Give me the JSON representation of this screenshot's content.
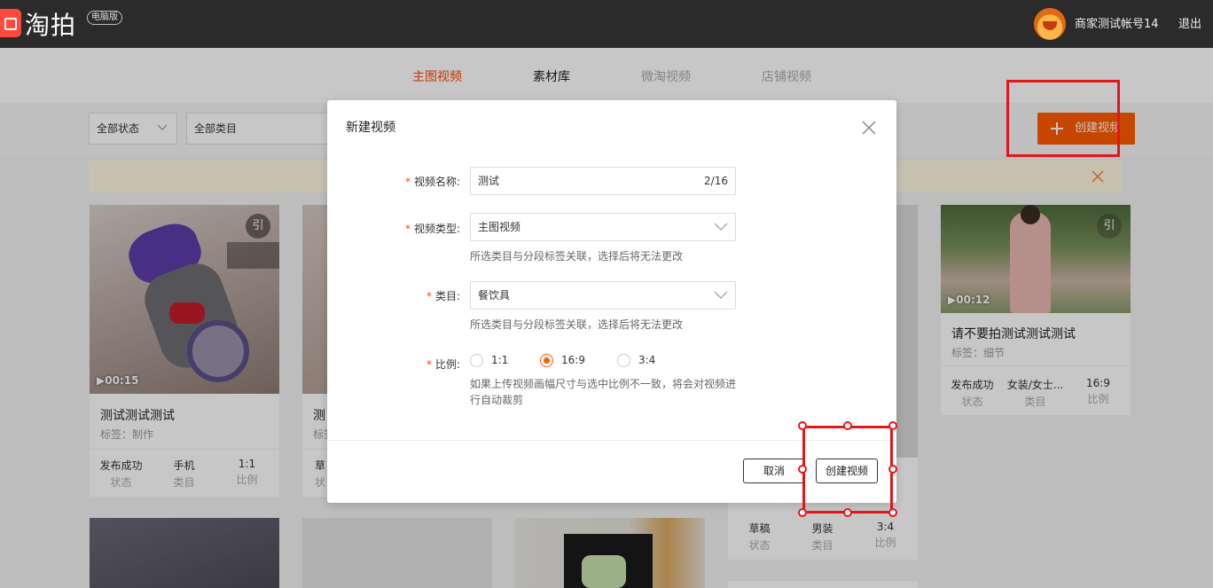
{
  "topbar": {
    "logo_text": "淘拍",
    "logo_badge": "电脑版",
    "user_name": "商家测试帐号14",
    "logout": "退出"
  },
  "nav": {
    "tabs": [
      {
        "label": "主图视频",
        "state": "active"
      },
      {
        "label": "素材库",
        "state": "normal"
      },
      {
        "label": "微淘视频",
        "state": "disabled"
      },
      {
        "label": "店铺视频",
        "state": "disabled"
      }
    ]
  },
  "filters": {
    "status": "全部状态",
    "category": "全部类目",
    "create_button": "创建视频"
  },
  "cards": [
    {
      "title": "测试测试测试",
      "tag": "标签：制作",
      "duration": "00:15",
      "quote": "引",
      "stats": [
        {
          "v": "发布成功",
          "k": "状态"
        },
        {
          "v": "手机",
          "k": "类目"
        },
        {
          "v": "1:1",
          "k": "比例"
        }
      ]
    },
    {
      "title": "测",
      "tag": "标签",
      "stats": [
        {
          "v": "草",
          "k": "状"
        }
      ]
    },
    {
      "title": "",
      "tag": "",
      "stats": [
        {
          "v": "草稿",
          "k": "状态"
        },
        {
          "v": "男装",
          "k": "类目"
        },
        {
          "v": "3:4",
          "k": "比例"
        }
      ]
    },
    {
      "title": "请不要拍测试测试测试",
      "tag": "标签：细节",
      "duration": "00:12",
      "quote": "引",
      "stats": [
        {
          "v": "发布成功",
          "k": "状态"
        },
        {
          "v": "女装/女士...",
          "k": "类目"
        },
        {
          "v": "16:9",
          "k": "比例"
        }
      ]
    }
  ],
  "modal": {
    "title": "新建视频",
    "name_label": "视频名称:",
    "name_value": "测试",
    "name_counter": "2/16",
    "type_label": "视频类型:",
    "type_value": "主图视频",
    "type_hint": "所选类目与分段标签关联，选择后将无法更改",
    "category_label": "类目:",
    "category_value": "餐饮具",
    "category_hint": "所选类目与分段标签关联，选择后将无法更改",
    "ratio_label": "比例:",
    "ratio_options": [
      "1:1",
      "16:9",
      "3:4"
    ],
    "ratio_selected": "16:9",
    "ratio_hint_1": "如果上传视频画幅尺寸与选中比例不一致，将会对视频进",
    "ratio_hint_2": "行自动裁剪",
    "cancel": "取消",
    "confirm": "创建视频"
  },
  "colors": {
    "accent": "#ff5a00",
    "active_tab": "#ff4400",
    "annotation": "#e5161a",
    "topbar": "#2b2b2b"
  }
}
